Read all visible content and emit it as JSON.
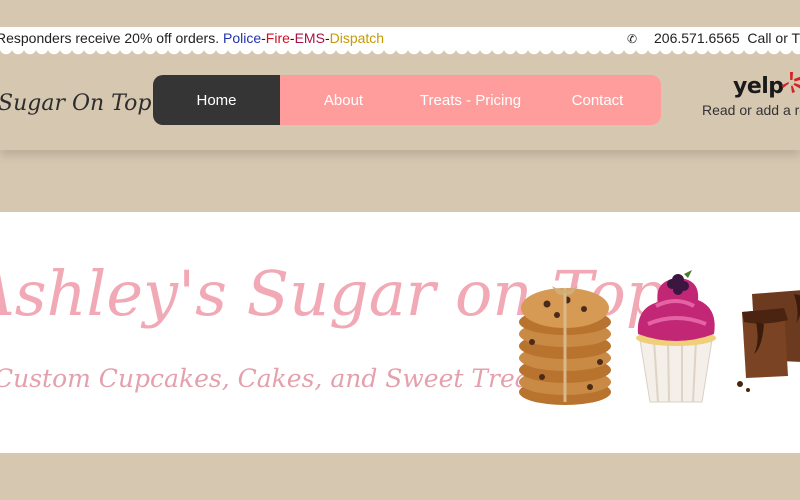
{
  "topbar": {
    "promo_prefix": "Responders receive 20% off orders. ",
    "police": "Police",
    "dash1": "-",
    "fire": "Fire",
    "dash2": "-",
    "ems": "EMS",
    "dash3": "-",
    "dispatch": "Dispatch",
    "phone": "206.571.6565",
    "call_text": "Call or T",
    "colors": {
      "police": "#2233aa",
      "fire": "#cc1122",
      "ems": "#aa1144",
      "dispatch": "#c79a00"
    }
  },
  "header": {
    "logo_text": "Sugar On Top",
    "nav": [
      {
        "label": "Home",
        "active": true
      },
      {
        "label": "About",
        "active": false
      },
      {
        "label": "Treats - Pricing",
        "active": false
      },
      {
        "label": "Contact",
        "active": false
      }
    ],
    "yelp": {
      "logo": "yelp",
      "text": "Read  or add a re"
    }
  },
  "banner": {
    "title": "Ashley's Sugar on Top",
    "subtitle": "Custom Cupcakes, Cakes, and Sweet Treats",
    "images": [
      "cookie-stack-icon",
      "cupcake-icon",
      "brownie-icon"
    ]
  },
  "colors": {
    "background": "#d6c7b0",
    "nav_pink": "#ff9d9d",
    "nav_active": "#353535",
    "banner_pink": "#f2a9b6"
  }
}
